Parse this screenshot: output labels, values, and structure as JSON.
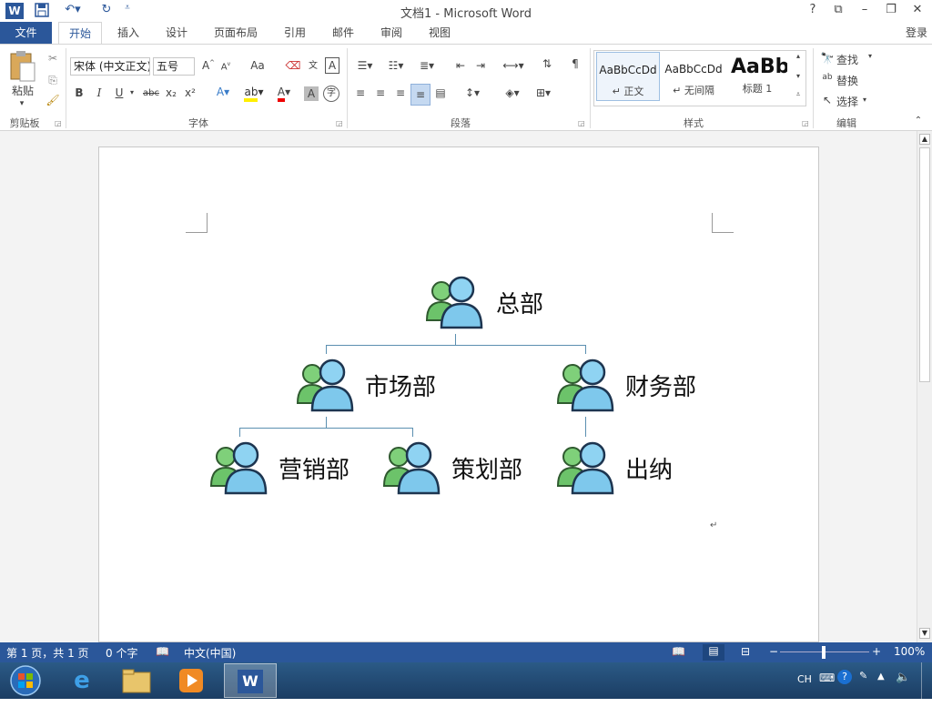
{
  "window": {
    "title": "文档1 - Microsoft Word",
    "help": "?",
    "min": "–",
    "max": "❐",
    "close": "✕",
    "restore_ribbon": "⧉",
    "sign_in": "登录"
  },
  "quick_access": {
    "save_icon": "save-icon",
    "undo_icon": "undo-icon",
    "redo_icon": "redo-icon",
    "app_icon": "W"
  },
  "tabs": [
    "文件",
    "开始",
    "插入",
    "设计",
    "页面布局",
    "引用",
    "邮件",
    "审阅",
    "视图"
  ],
  "ribbon": {
    "clipboard": {
      "paste": "粘贴",
      "label": "剪贴板"
    },
    "font": {
      "font_name": "宋体 (中文正文)",
      "font_size": "五号",
      "change_case": "Aa",
      "bold": "B",
      "italic": "I",
      "underline": "U",
      "strike": "abc",
      "subscript": "x₂",
      "superscript": "x²",
      "label": "字体"
    },
    "paragraph": {
      "label": "段落"
    },
    "styles": {
      "items": [
        {
          "preview": "AaBbCcDd",
          "name": "↵ 正文"
        },
        {
          "preview": "AaBbCcDd",
          "name": "↵ 无间隔"
        },
        {
          "preview": "AaBb",
          "name": "标题 1"
        }
      ],
      "label": "样式"
    },
    "editing": {
      "find": "查找",
      "replace": "替换",
      "select": "选择",
      "label": "编辑"
    }
  },
  "document": {
    "org_chart": {
      "root": "总部",
      "level2": [
        "市场部",
        "财务部"
      ],
      "level3": [
        "营销部",
        "策划部",
        "出纳"
      ]
    },
    "paragraph_mark": "↵"
  },
  "status_bar": {
    "page": "第 1 页，共 1 页",
    "words": "0 个字",
    "language": "中文(中国)",
    "zoom": "100%"
  },
  "taskbar": {
    "tray_lang": "CH",
    "items": [
      "start-orb",
      "ie-icon",
      "explorer-icon",
      "media-player-icon",
      "word-icon"
    ]
  }
}
